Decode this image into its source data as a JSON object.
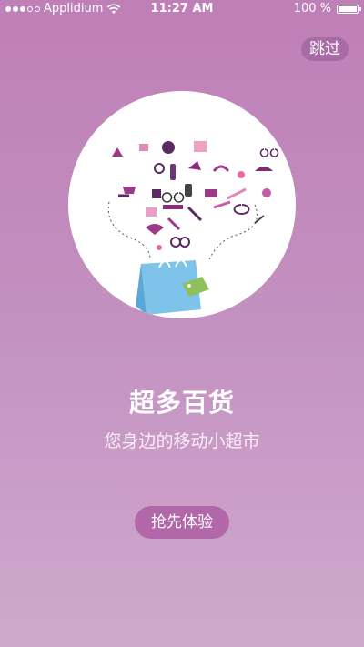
{
  "status_bar": {
    "carrier": "Applidium",
    "time": "11:27 AM",
    "battery": "100 %",
    "icons": [
      "signal-icon",
      "wifi-icon",
      "battery-icon"
    ]
  },
  "skip_label": "跳过",
  "onboarding": {
    "title": "超多百货",
    "subtitle": "您身边的移动小超市",
    "cta_label": "抢先体验",
    "illustration": "shopping-bag-with-items-icon"
  },
  "colors": {
    "background_top": "#bf7fb7",
    "background_bottom": "#cfa9cd",
    "accent": "#b268a8"
  }
}
